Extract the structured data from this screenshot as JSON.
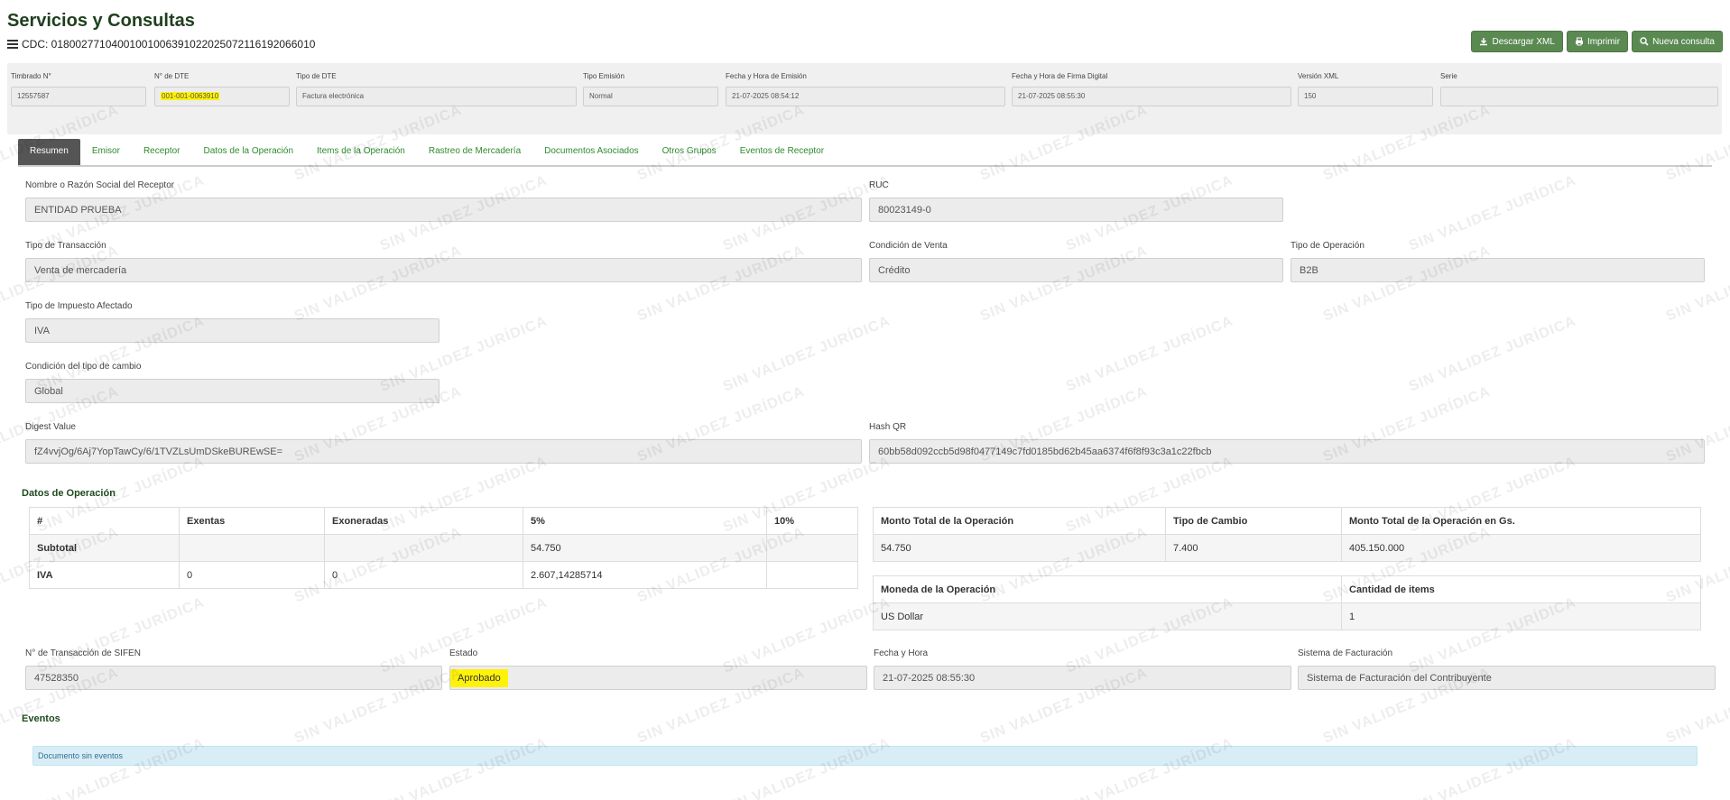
{
  "header": {
    "title": "Servicios y Consultas",
    "cdc_label": "CDC: 01800277104001001006391022025072116192066010",
    "buttons": {
      "download": "Descargar XML",
      "print": "Imprimir",
      "new_query": "Nueva consulta"
    }
  },
  "summary": {
    "timbrado_label": "Timbrado N°",
    "timbrado": "12557587",
    "dte_no_label": "N° de DTE",
    "dte_no": "001-001-0063910",
    "dte_type_label": "Tipo de DTE",
    "dte_type": "Factura electrónica",
    "emission_type_label": "Tipo Emisión",
    "emission_type": "Normal",
    "emission_date_label": "Fecha y Hora de Emisión",
    "emission_date": "21-07-2025 08:54:12",
    "signature_date_label": "Fecha y Hora de Firma Digital",
    "signature_date": "21-07-2025 08:55:30",
    "xml_version_label": "Versión XML",
    "xml_version": "150",
    "serie_label": "Serie",
    "serie": ""
  },
  "tabs": [
    "Resumen",
    "Emisor",
    "Receptor",
    "Datos de la Operación",
    "Items de la Operación",
    "Rastreo de Mercadería",
    "Documentos Asociados",
    "Otros Grupos",
    "Eventos de Receptor"
  ],
  "resumen": {
    "receptor_name_label": "Nombre o Razón Social del Receptor",
    "receptor_name": "ENTIDAD PRUEBA",
    "ruc_label": "RUC",
    "ruc": "80023149-0",
    "transaction_type_label": "Tipo de Transacción",
    "transaction_type": "Venta de mercadería",
    "sale_condition_label": "Condición de Venta",
    "sale_condition": "Crédito",
    "operation_type_label": "Tipo de Operación",
    "operation_type": "B2B",
    "tax_type_label": "Tipo de Impuesto Afectado",
    "tax_type": "IVA",
    "exchange_condition_label": "Condición del tipo de cambio",
    "exchange_condition": "Global",
    "digest_label": "Digest Value",
    "digest": "fZ4vvjOg/6Aj7YopTawCy/6/1TVZLsUmDSkeBUREwSE=",
    "hashqr_label": "Hash QR",
    "hashqr": "60bb58d092ccb5d98f0477149c7fd0185bd62b45aa6374f6f8f93c3a1c22fbcb"
  },
  "operation": {
    "title": "Datos de Operación",
    "tax_table": {
      "headers": [
        "#",
        "Exentas",
        "Exoneradas",
        "5%",
        "10%"
      ],
      "rows": [
        [
          "Subtotal",
          "",
          "",
          "54.750",
          ""
        ],
        [
          "IVA",
          "0",
          "0",
          "2.607,14285714",
          ""
        ]
      ]
    },
    "totals_table": {
      "headers": [
        "Monto Total de la Operación",
        "Tipo de Cambio",
        "Monto Total de la Operación en Gs."
      ],
      "row": [
        "54.750",
        "7.400",
        "405.150.000"
      ]
    },
    "currency_table": {
      "headers": [
        "Moneda de la Operación",
        "Cantidad de items"
      ],
      "row": [
        "US Dollar",
        "1"
      ]
    }
  },
  "status": {
    "sifen_label": "N° de Transacción de SIFEN",
    "sifen": "47528350",
    "state_label": "Estado",
    "state": "Aprobado",
    "datetime_label": "Fecha y Hora",
    "datetime": "21-07-2025 08:55:30",
    "billing_system_label": "Sistema de Facturación",
    "billing_system": "Sistema de Facturación del Contribuyente"
  },
  "events": {
    "title": "Eventos",
    "message": "Documento sin eventos"
  },
  "watermark_text": "SIN VALIDEZ JURÍDICA",
  "colors": {
    "button_green": "#5a8a52",
    "tab_link_green": "#2e8b2e",
    "active_tab": "#555555",
    "highlight": "#fff20a",
    "alert_bg": "#d9edf7"
  }
}
